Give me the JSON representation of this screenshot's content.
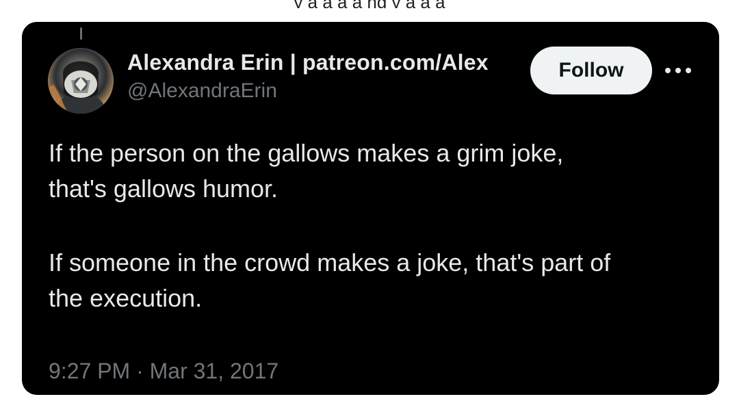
{
  "top_fragment": "y a a a a ng y a a a",
  "tweet": {
    "author": {
      "display_name": "Alexandra Erin | patreon.com/Alex",
      "handle": "@AlexandraErin"
    },
    "actions": {
      "follow_label": "Follow",
      "more_label": "More options"
    },
    "text": {
      "paragraph_1_line_1": "If the person on the gallows makes a grim joke,",
      "paragraph_1_line_2": "that's gallows humor.",
      "paragraph_2_line_1": "If someone in the crowd makes a joke, that's part of",
      "paragraph_2_line_2": "the execution."
    },
    "timestamp": "9:27 PM · Mar 31, 2017"
  },
  "icons": {
    "avatar": "profile-avatar-icon",
    "more": "more-options-icon"
  },
  "colors": {
    "card_background": "#000000",
    "primary_text": "#e7e9ea",
    "secondary_text": "#71767b",
    "follow_background": "#eff3f4",
    "follow_text": "#0f1419"
  }
}
